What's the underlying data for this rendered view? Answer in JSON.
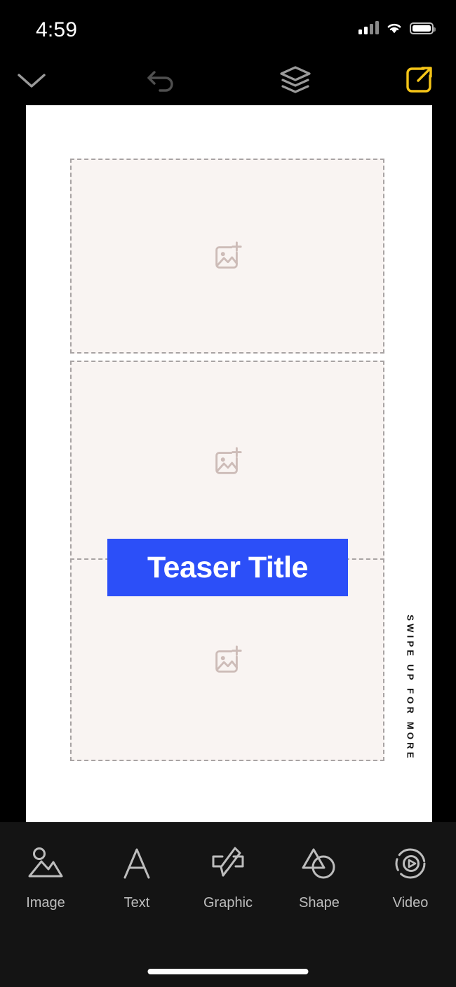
{
  "status_bar": {
    "time": "4:59",
    "signal_icon": "cellular-signal-icon",
    "wifi_icon": "wifi-icon",
    "battery_icon": "battery-icon",
    "signal_bars_filled": 2,
    "signal_bars_total": 4
  },
  "top_toolbar": {
    "collapse": {
      "label": "Collapse",
      "icon": "chevron-down-icon",
      "color": "#9a9a9a"
    },
    "undo": {
      "label": "Undo",
      "icon": "undo-arrow-icon",
      "color": "#4f4f4f"
    },
    "layers": {
      "label": "Layers",
      "icon": "layers-icon",
      "color": "#9a9a9a"
    },
    "export": {
      "label": "Export",
      "icon": "export-share-icon",
      "color": "#f5c518"
    }
  },
  "canvas": {
    "background": "#ffffff",
    "placeholders": [
      {
        "name": "image-placeholder-1",
        "icon": "add-image-icon",
        "fill": "#f9f4f2",
        "border": "#a8a3a3"
      },
      {
        "name": "image-placeholder-2",
        "icon": "add-image-icon",
        "fill": "#f9f4f2",
        "border": "#a8a3a3"
      },
      {
        "name": "image-placeholder-3",
        "icon": "add-image-icon",
        "fill": "#f9f4f2",
        "border": "#a8a3a3"
      }
    ],
    "teaser_title": {
      "text": "Teaser Title",
      "background": "#2c4ff8",
      "text_color": "#ffffff"
    },
    "swipe_label": {
      "text": "SWIPE UP FOR MORE",
      "color": "#111111"
    }
  },
  "bottom_toolbar": {
    "tabs": [
      {
        "label": "Image",
        "icon": "image-mountain-icon"
      },
      {
        "label": "Text",
        "icon": "text-letter-a-icon"
      },
      {
        "label": "Graphic",
        "icon": "paintbrush-graphic-icon"
      },
      {
        "label": "Shape",
        "icon": "shapes-triangle-circle-icon"
      },
      {
        "label": "Video",
        "icon": "video-play-circle-icon"
      }
    ],
    "label_color": "#bdbdbd",
    "icon_color": "#bdbdbd"
  },
  "home_indicator": {
    "name": "home-indicator"
  }
}
